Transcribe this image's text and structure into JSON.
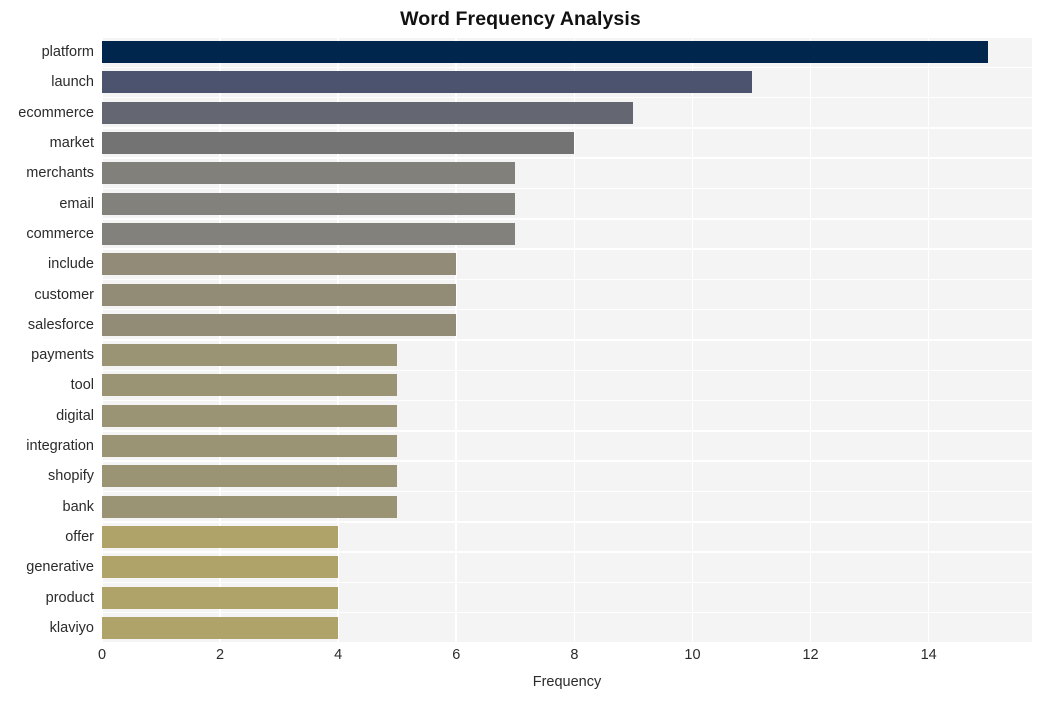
{
  "chart_data": {
    "type": "bar",
    "orientation": "horizontal",
    "title": "Word Frequency Analysis",
    "xlabel": "Frequency",
    "ylabel": "",
    "categories": [
      "platform",
      "launch",
      "ecommerce",
      "market",
      "merchants",
      "email",
      "commerce",
      "include",
      "customer",
      "salesforce",
      "payments",
      "tool",
      "digital",
      "integration",
      "shopify",
      "bank",
      "offer",
      "generative",
      "product",
      "klaviyo"
    ],
    "values": [
      15,
      11,
      9,
      8,
      7,
      7,
      7,
      6,
      6,
      6,
      5,
      5,
      5,
      5,
      5,
      5,
      4,
      4,
      4,
      4
    ],
    "bar_colors": [
      "#00264d",
      "#4b536e",
      "#646771",
      "#737373",
      "#82807a",
      "#83817b",
      "#83817b",
      "#918b77",
      "#928c77",
      "#928c77",
      "#9b9474",
      "#9b9474",
      "#9b9474",
      "#9b9474",
      "#9b9474",
      "#9b9474",
      "#b0a36a",
      "#b0a36a",
      "#b0a36a",
      "#b0a36a"
    ],
    "xlim": [
      0,
      15.75
    ],
    "xticks": [
      0,
      2,
      4,
      6,
      8,
      10,
      12,
      14
    ],
    "xtick_labels": [
      "0",
      "2",
      "4",
      "6",
      "8",
      "10",
      "12",
      "14"
    ],
    "grid": true,
    "grid_color": "#ffffff",
    "plot_background": "#f4f4f5",
    "figure_background": "#ffffff",
    "legend": null,
    "style": "whitegrid"
  }
}
